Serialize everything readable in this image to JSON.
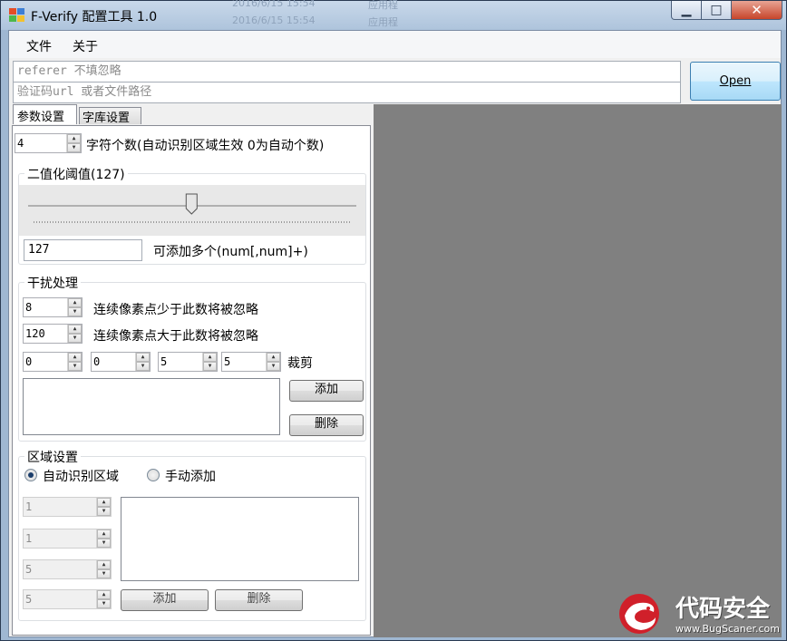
{
  "window": {
    "title": "F-Verify 配置工具 1.0",
    "ghost_text": [
      "2016/6/15 15:54",
      "应用程",
      "2016/6/15 15:54",
      "应用程"
    ]
  },
  "menu": [
    "文件",
    "关于"
  ],
  "inputs": {
    "referer_placeholder": "referer 不填忽略",
    "captcha_placeholder": "验证码url 或者文件路径"
  },
  "open_button": "Open",
  "tabs": [
    "参数设置",
    "字库设置"
  ],
  "char_count": {
    "value": "4",
    "label": "字符个数(自动识别区域生效 0为自动个数)"
  },
  "threshold": {
    "title": "二值化阈值(127)",
    "slider_value": 127,
    "slider_max": 255,
    "input_value": "127",
    "hint": "可添加多个(num[,num]+)"
  },
  "noise": {
    "title": "干扰处理",
    "min_value": "8",
    "min_label": "连续像素点少于此数将被忽略",
    "max_value": "120",
    "max_label": "连续像素点大于此数将被忽略",
    "crop_values": [
      "0",
      "0",
      "5",
      "5"
    ],
    "crop_label": "裁剪",
    "add_label": "添加",
    "delete_label": "删除"
  },
  "region": {
    "title": "区域设置",
    "auto_label": "自动识别区域",
    "manual_label": "手动添加",
    "auto_selected": true,
    "values": [
      "1",
      "1",
      "5",
      "5"
    ],
    "add_label": "添加",
    "delete_label": "删除"
  },
  "watermark": {
    "name": "代码安全",
    "site": "www.BugScaner.com"
  },
  "colors": {
    "preview_bg": "#808080",
    "titlebar": "#aec4dc",
    "close": "#c7452b",
    "logo_red": "#d0202a"
  }
}
